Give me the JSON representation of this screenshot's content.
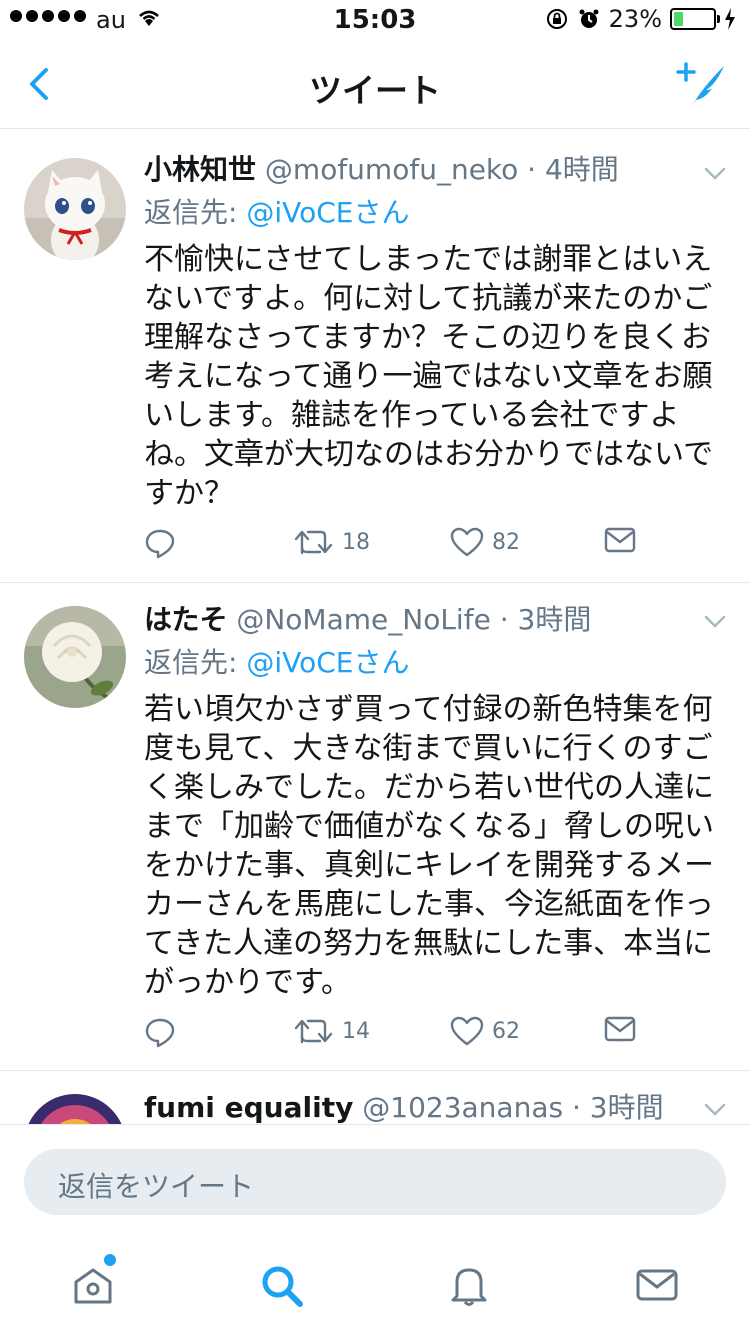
{
  "status_bar": {
    "carrier": "au",
    "time": "15:03",
    "battery": "23%",
    "battery_level": 0.23
  },
  "nav": {
    "title": "ツイート",
    "back_icon": "chevron-left-icon",
    "compose_icon": "compose-tweet-icon"
  },
  "tweets": [
    {
      "name": "小林知世",
      "handle": "@mofumofu_neko",
      "dot": "·",
      "time": "4時間",
      "reply_label": "返信先: ",
      "reply_to": "@iVoCEさん",
      "text": "不愉快にさせてしまったでは謝罪とはいえ\nないですよ。何に対して抗議が来たのかご\n理解なさってますか？そこの辺りを良くお\n考えになって通り一遍ではない文章をお願\nいします。雑誌を作っている会社ですよ\nね。文章が大切なのはお分かりではないで\nすか？",
      "retweets": "18",
      "likes": "82"
    },
    {
      "name": "はたそ",
      "handle": "@NoMame_NoLife",
      "dot": "·",
      "time": "3時間",
      "reply_label": "返信先: ",
      "reply_to": "@iVoCEさん",
      "text": "若い頃欠かさず買って付録の新色特集を何\n度も見て、大きな街まで買いに行くのすご\nく楽しみでした。だから若い世代の人達に\nまで「加齢で価値がなくなる」脅しの呪い\nをかけた事、真剣にキレイを開発するメー\nカーさんを馬鹿にした事、今迄紙面を作っ\nてきた人達の努力を無駄にした事、本当に\nがっかりです。",
      "retweets": "14",
      "likes": "62"
    },
    {
      "name": "fumi equality",
      "handle": "@1023ananas",
      "dot": "·",
      "time": "3時間"
    }
  ],
  "composer": {
    "placeholder": "返信をツイート"
  },
  "tabbar": {
    "items": [
      "home-icon",
      "search-icon",
      "notifications-icon",
      "messages-icon"
    ]
  },
  "colors": {
    "accent": "#1da1f2",
    "muted": "#657786",
    "divider": "#e1e8ed"
  }
}
